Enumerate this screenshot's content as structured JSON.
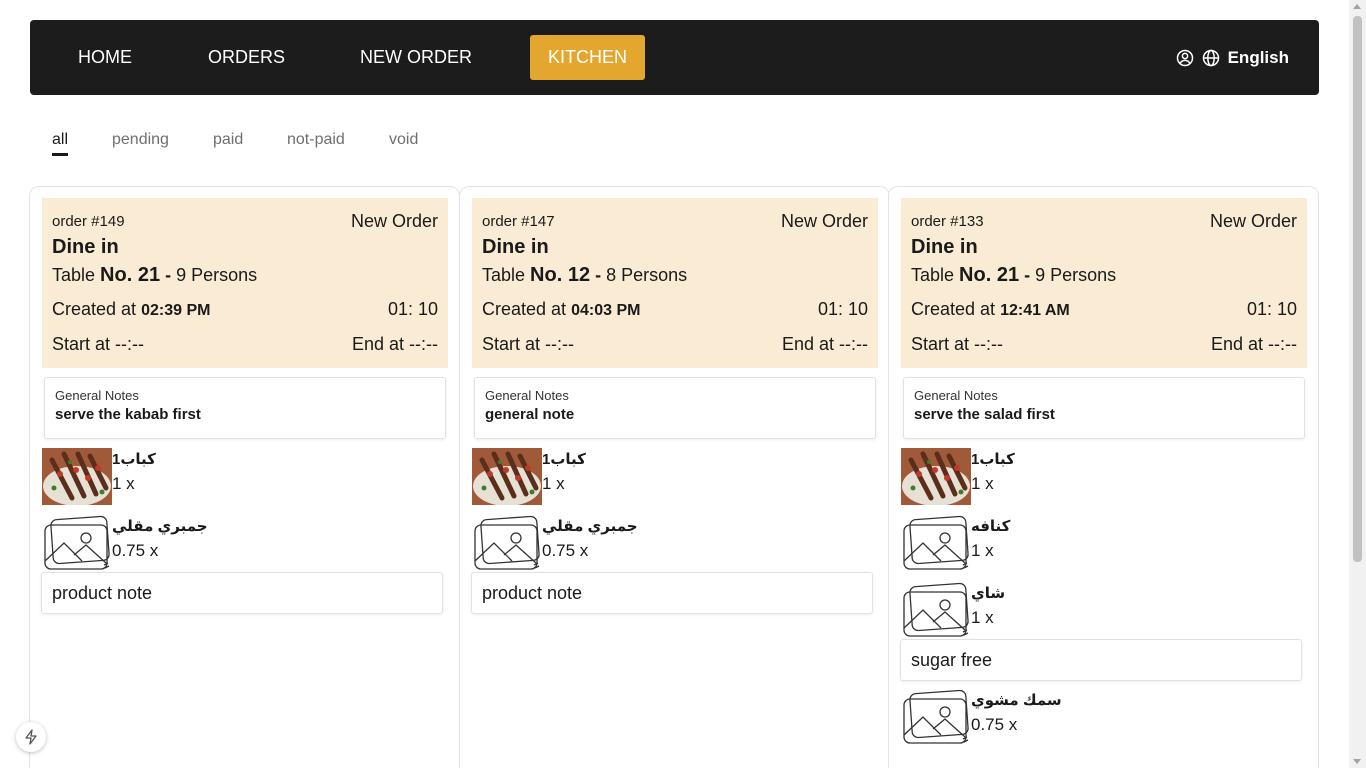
{
  "nav": {
    "items": [
      {
        "label": "HOME"
      },
      {
        "label": "ORDERS"
      },
      {
        "label": "NEW ORDER"
      },
      {
        "label": "KITCHEN"
      }
    ],
    "language": "English",
    "accent_color": "#e3a72f",
    "icons": [
      "user-icon",
      "globe-icon"
    ]
  },
  "tabs": [
    {
      "label": "all"
    },
    {
      "label": "pending"
    },
    {
      "label": "paid"
    },
    {
      "label": "not-paid"
    },
    {
      "label": "void"
    }
  ],
  "labels": {
    "table": "Table",
    "persons_sep": "-",
    "created_at": "Created at",
    "start_at": "Start at",
    "end_at": "End at",
    "general_notes": "General Notes"
  },
  "orders": [
    {
      "number": "order #149",
      "status": "New Order",
      "type": "Dine in",
      "table": "No. 21",
      "persons": "9 Persons",
      "created": "02:39 PM",
      "timer": "01: 10",
      "start": "--:--",
      "end": "--:--",
      "notes": "serve the kabab first",
      "items": [
        {
          "name": "كباب1",
          "qty": "1 x",
          "image": "kabab-photo"
        },
        {
          "name": "جمبري مقلي",
          "qty": "0.75 x",
          "image": "placeholder-icon",
          "note": "product note"
        }
      ]
    },
    {
      "number": "order #147",
      "status": "New Order",
      "type": "Dine in",
      "table": "No. 12",
      "persons": "8 Persons",
      "created": "04:03 PM",
      "timer": "01: 10",
      "start": "--:--",
      "end": "--:--",
      "notes": "general note",
      "items": [
        {
          "name": "كباب1",
          "qty": "1 x",
          "image": "kabab-photo"
        },
        {
          "name": "جمبري مقلي",
          "qty": "0.75 x",
          "image": "placeholder-icon",
          "note": "product note"
        }
      ]
    },
    {
      "number": "order #133",
      "status": "New Order",
      "type": "Dine in",
      "table": "No. 21",
      "persons": "9 Persons",
      "created": "12:41 AM",
      "timer": "01: 10",
      "start": "--:--",
      "end": "--:--",
      "notes": "serve the salad first",
      "items": [
        {
          "name": "كباب1",
          "qty": "1 x",
          "image": "kabab-photo"
        },
        {
          "name": "كنافه",
          "qty": "1 x",
          "image": "placeholder-icon"
        },
        {
          "name": "شاي",
          "qty": "1 x",
          "image": "placeholder-icon",
          "note": "sugar free"
        },
        {
          "name": "سمك مشوي",
          "qty": "0.75 x",
          "image": "placeholder-icon"
        }
      ]
    }
  ]
}
